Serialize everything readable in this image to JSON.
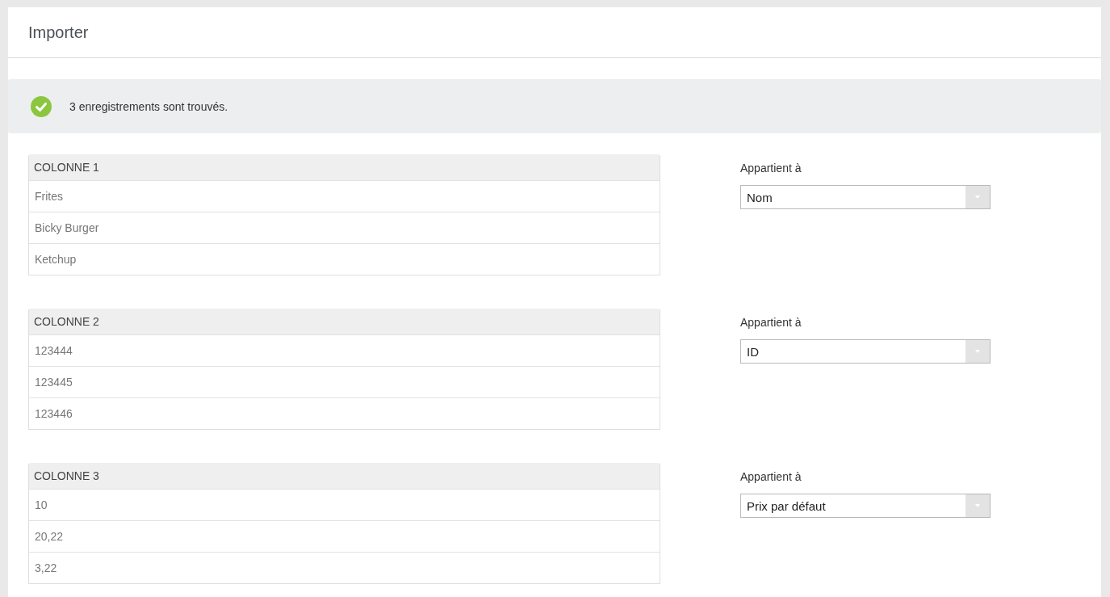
{
  "window": {
    "title": "Importer"
  },
  "banner": {
    "kind": "success",
    "message": "3 enregistrements sont trouvés."
  },
  "mappings": [
    {
      "column": "COLONNE 1",
      "rows": [
        "Frites",
        "Bicky Burger",
        "Ketchup"
      ],
      "label": "Appartient à",
      "value": "Nom"
    },
    {
      "column": "COLONNE 2",
      "rows": [
        "123444",
        "123445",
        "123446"
      ],
      "label": "Appartient à",
      "value": "ID"
    },
    {
      "column": "COLONNE 3",
      "rows": [
        "10",
        "20,22",
        "3,22"
      ],
      "label": "Appartient à",
      "value": "Prix par défaut"
    }
  ]
}
